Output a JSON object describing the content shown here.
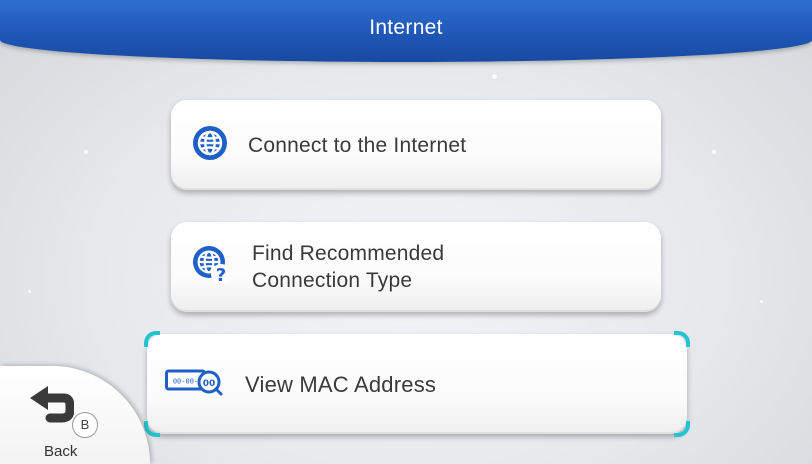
{
  "header": {
    "title": "Internet"
  },
  "menu": {
    "items": [
      {
        "label": "Connect to the Internet",
        "icon": "globe-icon"
      },
      {
        "label_line1": "Find Recommended",
        "label_line2": "Connection Type",
        "icon": "globe-question-icon"
      },
      {
        "label": "View MAC Address",
        "icon": "mac-address-icon",
        "selected": true
      }
    ]
  },
  "back": {
    "label": "Back",
    "button_hint": "B",
    "icon": "back-arrow-icon"
  },
  "colors": {
    "header_blue": "#1f57b7",
    "icon_blue": "#1f5fc8",
    "selection_cyan": "#23c4cf"
  }
}
